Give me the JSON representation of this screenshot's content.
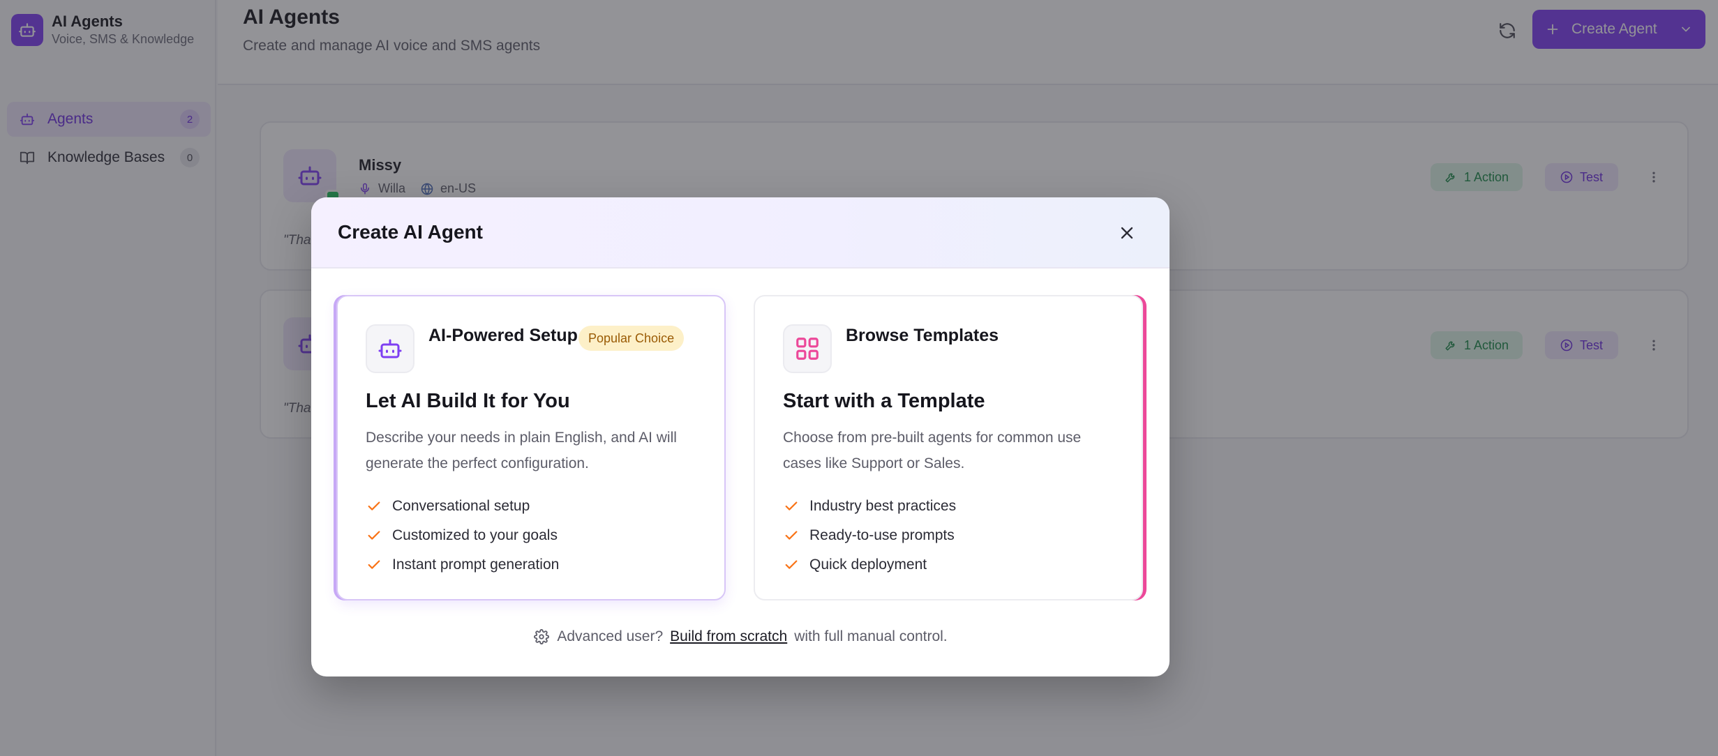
{
  "app": {
    "title": "AI Agents",
    "subtitle": "Voice, SMS & Knowledge"
  },
  "sidebar": {
    "items": [
      {
        "label": "Agents",
        "count": "2",
        "icon": "robot-icon"
      },
      {
        "label": "Knowledge Bases",
        "count": "0",
        "icon": "book-icon"
      }
    ]
  },
  "header": {
    "title": "AI Agents",
    "subtitle": "Create and manage AI voice and SMS agents",
    "create_label": "Create Agent"
  },
  "agents": [
    {
      "name": "Missy",
      "voice": "Willa",
      "language": "en-US",
      "quote": "\"Tha",
      "actions": "1 Action",
      "test": "Test"
    },
    {
      "name": "",
      "voice": "",
      "language": "",
      "quote": "\"Tha",
      "actions": "1 Action",
      "test": "Test"
    }
  ],
  "modal": {
    "title": "Create AI Agent",
    "options": [
      {
        "title": "AI-Powered Setup",
        "badge": "Popular Choice",
        "heading": "Let AI Build It for You",
        "description": "Describe your needs in plain English, and AI will generate the perfect configuration.",
        "features": [
          "Conversational setup",
          "Customized to your goals",
          "Instant prompt generation"
        ],
        "icon": "robot-icon"
      },
      {
        "title": "Browse Templates",
        "heading": "Start with a Template",
        "description": "Choose from pre-built agents for common use cases like Support or Sales.",
        "features": [
          "Industry best practices",
          "Ready-to-use prompts",
          "Quick deployment"
        ],
        "icon": "grid-icon"
      }
    ],
    "footer": {
      "prefix": "Advanced user?",
      "link": "Build from scratch",
      "suffix": "with full manual control."
    }
  },
  "colors": {
    "accent": "#7e3ff2",
    "check": "#f97316",
    "template_border": "#ec4899",
    "action_green": "#1b8a48"
  }
}
